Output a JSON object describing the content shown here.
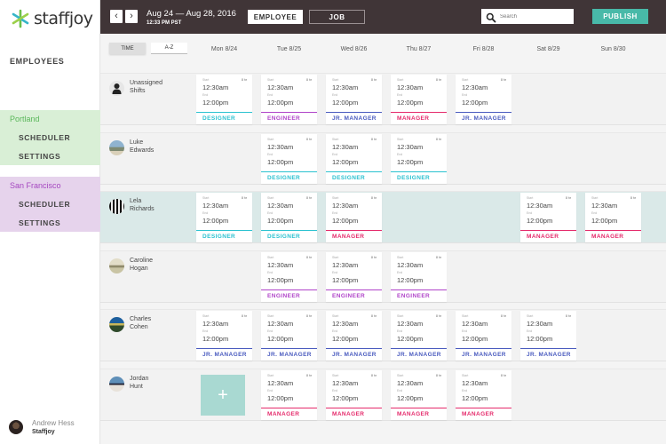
{
  "app": {
    "name": "staffjoy"
  },
  "colors": {
    "topbar": "#403537",
    "accent": "#48b9a8",
    "portland": "#5cb85c",
    "san_francisco": "#a547c0",
    "roles": {
      "DESIGNER": "#2bc2d0",
      "ENGINEER": "#b044c9",
      "JR. MANAGER": "#4a5bbf",
      "MANAGER": "#e52a6b"
    }
  },
  "sidebar": {
    "employees_label": "EMPLOYEES",
    "locations": [
      {
        "name": "Portland",
        "items": [
          "SCHEDULER",
          "SETTINGS"
        ]
      },
      {
        "name": "San Francisco",
        "items": [
          "SCHEDULER",
          "SETTINGS"
        ]
      }
    ],
    "user": {
      "name": "Andrew Hess",
      "org": "Staffjoy"
    }
  },
  "topbar": {
    "prev_icon": "chevron-left-icon",
    "next_icon": "chevron-right-icon",
    "date_range": "Aug 24 — Aug 28, 2016",
    "current_time": "12:33 PM PST",
    "view_toggle": {
      "employee_label": "EMPLOYEE",
      "job_label": "JOB",
      "active": "EMPLOYEE"
    },
    "search": {
      "placeholder": "Search",
      "value": ""
    },
    "publish_label": "PUBLISH"
  },
  "sort": {
    "time_label": "TIME",
    "az_label": "A-Z",
    "active": "TIME"
  },
  "days": [
    "Mon 8/24",
    "Tue 8/25",
    "Wed 8/26",
    "Thu 8/27",
    "Fri 8/28",
    "Sat 8/29",
    "Sun 8/30"
  ],
  "shift_labels": {
    "start": "Start",
    "end": "End"
  },
  "rows": [
    {
      "name_line1": "Unassigned",
      "name_line2": "Shifts",
      "avatar": "unassigned-avatar",
      "highlight": false,
      "shifts": [
        {
          "day": 0,
          "start": "12:30am",
          "end": "12:00pm",
          "hours": "8 hr",
          "role": "DESIGNER"
        },
        {
          "day": 1,
          "start": "12:30am",
          "end": "12:00pm",
          "hours": "8 hr",
          "role": "ENGINEER"
        },
        {
          "day": 2,
          "start": "12:30am",
          "end": "12:00pm",
          "hours": "8 hr",
          "role": "JR. MANAGER"
        },
        {
          "day": 3,
          "start": "12:30am",
          "end": "12:00pm",
          "hours": "8 hr",
          "role": "MANAGER"
        },
        {
          "day": 4,
          "start": "12:30am",
          "end": "12:00pm",
          "hours": "8 hr",
          "role": "JR. MANAGER"
        }
      ]
    },
    {
      "name_line1": "Luke",
      "name_line2": "Edwards",
      "avatar": "photo-avatar",
      "highlight": false,
      "shifts": [
        {
          "day": 1,
          "start": "12:30am",
          "end": "12:00pm",
          "hours": "8 hr",
          "role": "DESIGNER"
        },
        {
          "day": 2,
          "start": "12:30am",
          "end": "12:00pm",
          "hours": "8 hr",
          "role": "DESIGNER"
        },
        {
          "day": 3,
          "start": "12:30am",
          "end": "12:00pm",
          "hours": "8 hr",
          "role": "DESIGNER"
        }
      ]
    },
    {
      "name_line1": "Lela",
      "name_line2": "Richards",
      "avatar": "photo-avatar",
      "highlight": true,
      "shifts": [
        {
          "day": 0,
          "start": "12:30am",
          "end": "12:00pm",
          "hours": "8 hr",
          "role": "DESIGNER"
        },
        {
          "day": 1,
          "start": "12:30am",
          "end": "12:00pm",
          "hours": "8 hr",
          "role": "DESIGNER"
        },
        {
          "day": 2,
          "start": "12:30am",
          "end": "12:00pm",
          "hours": "8 hr",
          "role": "MANAGER"
        },
        {
          "day": 5,
          "start": "12:30am",
          "end": "12:00pm",
          "hours": "8 hr",
          "role": "MANAGER"
        },
        {
          "day": 6,
          "start": "12:30am",
          "end": "12:00pm",
          "hours": "8 hr",
          "role": "MANAGER"
        }
      ]
    },
    {
      "name_line1": "Caroline",
      "name_line2": "Hogan",
      "avatar": "photo-avatar",
      "highlight": false,
      "shifts": [
        {
          "day": 1,
          "start": "12:30am",
          "end": "12:00pm",
          "hours": "8 hr",
          "role": "ENGINEER"
        },
        {
          "day": 2,
          "start": "12:30am",
          "end": "12:00pm",
          "hours": "8 hr",
          "role": "ENGINEER"
        },
        {
          "day": 3,
          "start": "12:30am",
          "end": "12:00pm",
          "hours": "8 hr",
          "role": "ENGINEER"
        }
      ]
    },
    {
      "name_line1": "Charles",
      "name_line2": "Cohen",
      "avatar": "photo-avatar",
      "highlight": false,
      "shifts": [
        {
          "day": 0,
          "start": "12:30am",
          "end": "12:00pm",
          "hours": "8 hr",
          "role": "JR. MANAGER"
        },
        {
          "day": 1,
          "start": "12:30am",
          "end": "12:00pm",
          "hours": "8 hr",
          "role": "JR. MANAGER"
        },
        {
          "day": 2,
          "start": "12:30am",
          "end": "12:00pm",
          "hours": "8 hr",
          "role": "JR. MANAGER"
        },
        {
          "day": 3,
          "start": "12:30am",
          "end": "12:00pm",
          "hours": "8 hr",
          "role": "JR. MANAGER"
        },
        {
          "day": 4,
          "start": "12:30am",
          "end": "12:00pm",
          "hours": "8 hr",
          "role": "JR. MANAGER"
        },
        {
          "day": 5,
          "start": "12:30am",
          "end": "12:00pm",
          "hours": "8 hr",
          "role": "JR. MANAGER"
        }
      ]
    },
    {
      "name_line1": "Jordan",
      "name_line2": "Hunt",
      "avatar": "photo-avatar",
      "highlight": false,
      "add_shift_day": 0,
      "add_shift_icon": "+",
      "shifts": [
        {
          "day": 1,
          "start": "12:30am",
          "end": "12:00pm",
          "hours": "8 hr",
          "role": "MANAGER"
        },
        {
          "day": 2,
          "start": "12:30am",
          "end": "12:00pm",
          "hours": "8 hr",
          "role": "MANAGER"
        },
        {
          "day": 3,
          "start": "12:30am",
          "end": "12:00pm",
          "hours": "8 hr",
          "role": "MANAGER"
        },
        {
          "day": 4,
          "start": "12:30am",
          "end": "12:00pm",
          "hours": "8 hr",
          "role": "MANAGER"
        }
      ]
    }
  ]
}
